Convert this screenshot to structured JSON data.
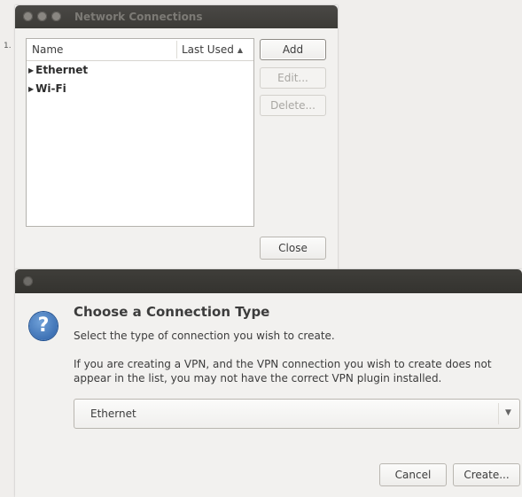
{
  "edge_text": "1.",
  "network_connections": {
    "title": "Network Connections",
    "columns": {
      "name": "Name",
      "last_used": "Last Used"
    },
    "rows": [
      {
        "label": "Ethernet"
      },
      {
        "label": "Wi-Fi"
      }
    ],
    "buttons": {
      "add": "Add",
      "edit": "Edit...",
      "delete": "Delete...",
      "close": "Close"
    }
  },
  "connection_type_dialog": {
    "heading": "Choose a Connection Type",
    "subheading": "Select the type of connection you wish to create.",
    "paragraph": "If you are creating a VPN, and the VPN connection you wish to create does not appear in the list, you may not have the correct VPN plugin installed.",
    "selected_type": "Ethernet",
    "buttons": {
      "cancel": "Cancel",
      "create": "Create..."
    }
  }
}
